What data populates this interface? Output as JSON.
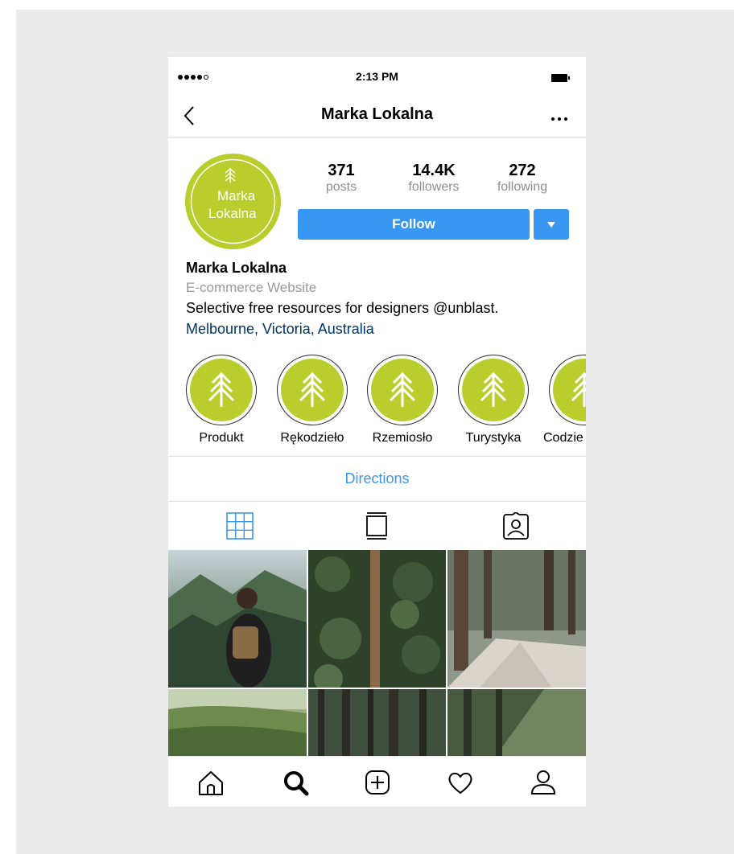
{
  "status": {
    "time": "2:13 PM"
  },
  "header": {
    "back_icon": "chevron-left-icon",
    "title": "Marka Lokalna",
    "more_icon": "more-horizontal-icon"
  },
  "profile": {
    "avatar_text_line1": "Marka",
    "avatar_text_line2": "Lokalna",
    "stats": [
      {
        "value": "371",
        "label": "posts"
      },
      {
        "value": "14.4K",
        "label": "followers"
      },
      {
        "value": "272",
        "label": "following"
      }
    ],
    "follow_label": "Follow",
    "name": "Marka Lokalna",
    "category": "E-commerce Website",
    "description": "Selective free resources for designers @unblast.",
    "location": "Melbourne, Victoria, Australia",
    "brand_color": "#b9ce2c",
    "accent_color": "#3897f0"
  },
  "highlights": [
    {
      "label": "Produkt"
    },
    {
      "label": "Rękodzieło"
    },
    {
      "label": "Rzemiosło"
    },
    {
      "label": "Turystyka"
    },
    {
      "label": "Codzie"
    }
  ],
  "directions_label": "Directions",
  "tabs": [
    "grid-icon",
    "feed-icon",
    "tagged-icon"
  ],
  "bottom_nav": [
    "home-icon",
    "search-icon",
    "add-post-icon",
    "heart-icon",
    "profile-icon"
  ]
}
